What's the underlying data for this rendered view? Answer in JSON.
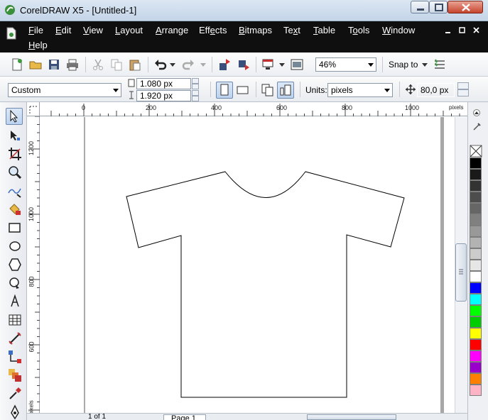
{
  "window": {
    "title": "CorelDRAW X5 - [Untitled-1]"
  },
  "menu": {
    "items": [
      {
        "pre": "",
        "key": "F",
        "post": "ile"
      },
      {
        "pre": "",
        "key": "E",
        "post": "dit"
      },
      {
        "pre": "",
        "key": "V",
        "post": "iew"
      },
      {
        "pre": "",
        "key": "L",
        "post": "ayout"
      },
      {
        "pre": "",
        "key": "A",
        "post": "rrange"
      },
      {
        "pre": "Eff",
        "key": "e",
        "post": "cts"
      },
      {
        "pre": "",
        "key": "B",
        "post": "itmaps"
      },
      {
        "pre": "Te",
        "key": "x",
        "post": "t"
      },
      {
        "pre": "",
        "key": "T",
        "post": "able"
      },
      {
        "pre": "T",
        "key": "o",
        "post": "ols"
      },
      {
        "pre": "",
        "key": "W",
        "post": "indow"
      },
      {
        "pre": "",
        "key": "H",
        "post": "elp"
      }
    ]
  },
  "standard_toolbar": {
    "zoom_value": "46%",
    "snap_label": "Snap to"
  },
  "property_bar": {
    "paper_preset": "Custom",
    "width_value": "1.080 px",
    "height_value": "1.920 px",
    "units_label": "Units:",
    "units_value": "pixels",
    "nudge_value": "80,0 px"
  },
  "ruler": {
    "top_labels": [
      "0",
      "200",
      "400",
      "600",
      "800",
      "1000"
    ],
    "unit": "pixels",
    "left_labels": [
      "1200",
      "1000",
      "800",
      "600"
    ],
    "left_unit": "pixels"
  },
  "pagebar": {
    "page_count": "1 of 1",
    "page_tab": "Page 1"
  },
  "palette": {
    "colors": [
      "#000000",
      "#1a1a1a",
      "#333333",
      "#4d4d4d",
      "#666666",
      "#808080",
      "#999999",
      "#b3b3b3",
      "#cccccc",
      "#e6e6e6",
      "#ffffff",
      "#0000ff",
      "#00ffff",
      "#00ff00",
      "#00cc00",
      "#ffff00",
      "#ff0000",
      "#ff00ff",
      "#9900cc",
      "#ff8000",
      "#ffb3c6"
    ]
  },
  "icons": {
    "toolbox": [
      "pick-tool-icon",
      "shape-tool-icon",
      "crop-tool-icon",
      "zoom-tool-icon",
      "freehand-tool-icon",
      "smart-fill-icon",
      "rectangle-tool-icon",
      "ellipse-tool-icon",
      "polygon-tool-icon",
      "basic-shapes-icon",
      "text-tool-icon",
      "table-tool-icon",
      "dimension-tool-icon",
      "connector-tool-icon",
      "blend-tool-icon",
      "eyedropper-tool-icon",
      "outline-pen-icon"
    ]
  }
}
